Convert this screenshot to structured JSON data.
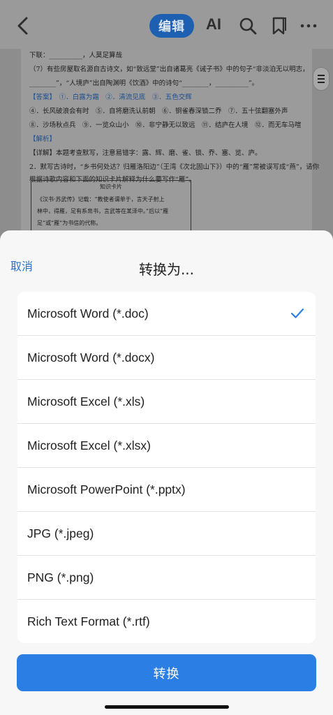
{
  "toolbar": {
    "edit_label": "编辑",
    "ai_label": "AI",
    "icons": [
      "back-icon",
      "search-icon",
      "bookmark-icon",
      "more-icon"
    ]
  },
  "document": {
    "lines": [
      "下联：__________，人莫足算哉",
      "（7）有些房屋取名源自古诗文，如“致远堂”出自诸葛亮《诫子书》中的句子“非淡泊无以明志，",
      "________”，“人境庐”出自陶渊明《饮酒》中的诗句“________，__________”。",
      "【答案】　①．白露为霜　②．清流见底　③．五色交辉",
      "④．长风破浪会有时　⑤．自将磨洗认前朝　⑥．铜雀春深锁二乔　⑦．五十弦翻塞外声",
      "⑧．沙场秋点兵　⑨．一览众山小　⑩．非宁静无以致远　⑪．结庐在人境　⑫．而无车马喧",
      "【解析】",
      "【详解】本题考查默写，注意易错字：露、辉、磨、雀、锁、乔、塞、览、庐。",
      "2．默写古诗时，“乡书何处达？归雁洛阳边”（王湾《次北固山下》）中的“雁”常被误写成“燕”，请你",
      "根据诗歌内容和下面的知识卡片解释为什么要写作“雁”。"
    ],
    "card_title": "知识卡片",
    "card_lines": [
      "《汉书·苏武传》记载：“教使者谓单于，言天子射上",
      "林中，得雁，足有系帛书，言武等在某泽中。”后以“雁",
      "足”或“雁”为书信的代称。"
    ]
  },
  "sheet": {
    "cancel_label": "取消",
    "title": "转换为...",
    "options": [
      {
        "label": "Microsoft Word (*.doc)",
        "selected": true
      },
      {
        "label": "Microsoft Word (*.docx)",
        "selected": false
      },
      {
        "label": "Microsoft Excel (*.xls)",
        "selected": false
      },
      {
        "label": "Microsoft Excel (*.xlsx)",
        "selected": false
      },
      {
        "label": "Microsoft PowerPoint (*.pptx)",
        "selected": false
      },
      {
        "label": "JPG (*.jpeg)",
        "selected": false
      },
      {
        "label": "PNG (*.png)",
        "selected": false
      },
      {
        "label": "Rich Text Format (*.rtf)",
        "selected": false
      }
    ],
    "convert_label": "转换"
  },
  "colors": {
    "accent": "#2b7ee3",
    "edit_button": "#1d5fb0",
    "cancel_text": "#2a73c8"
  }
}
